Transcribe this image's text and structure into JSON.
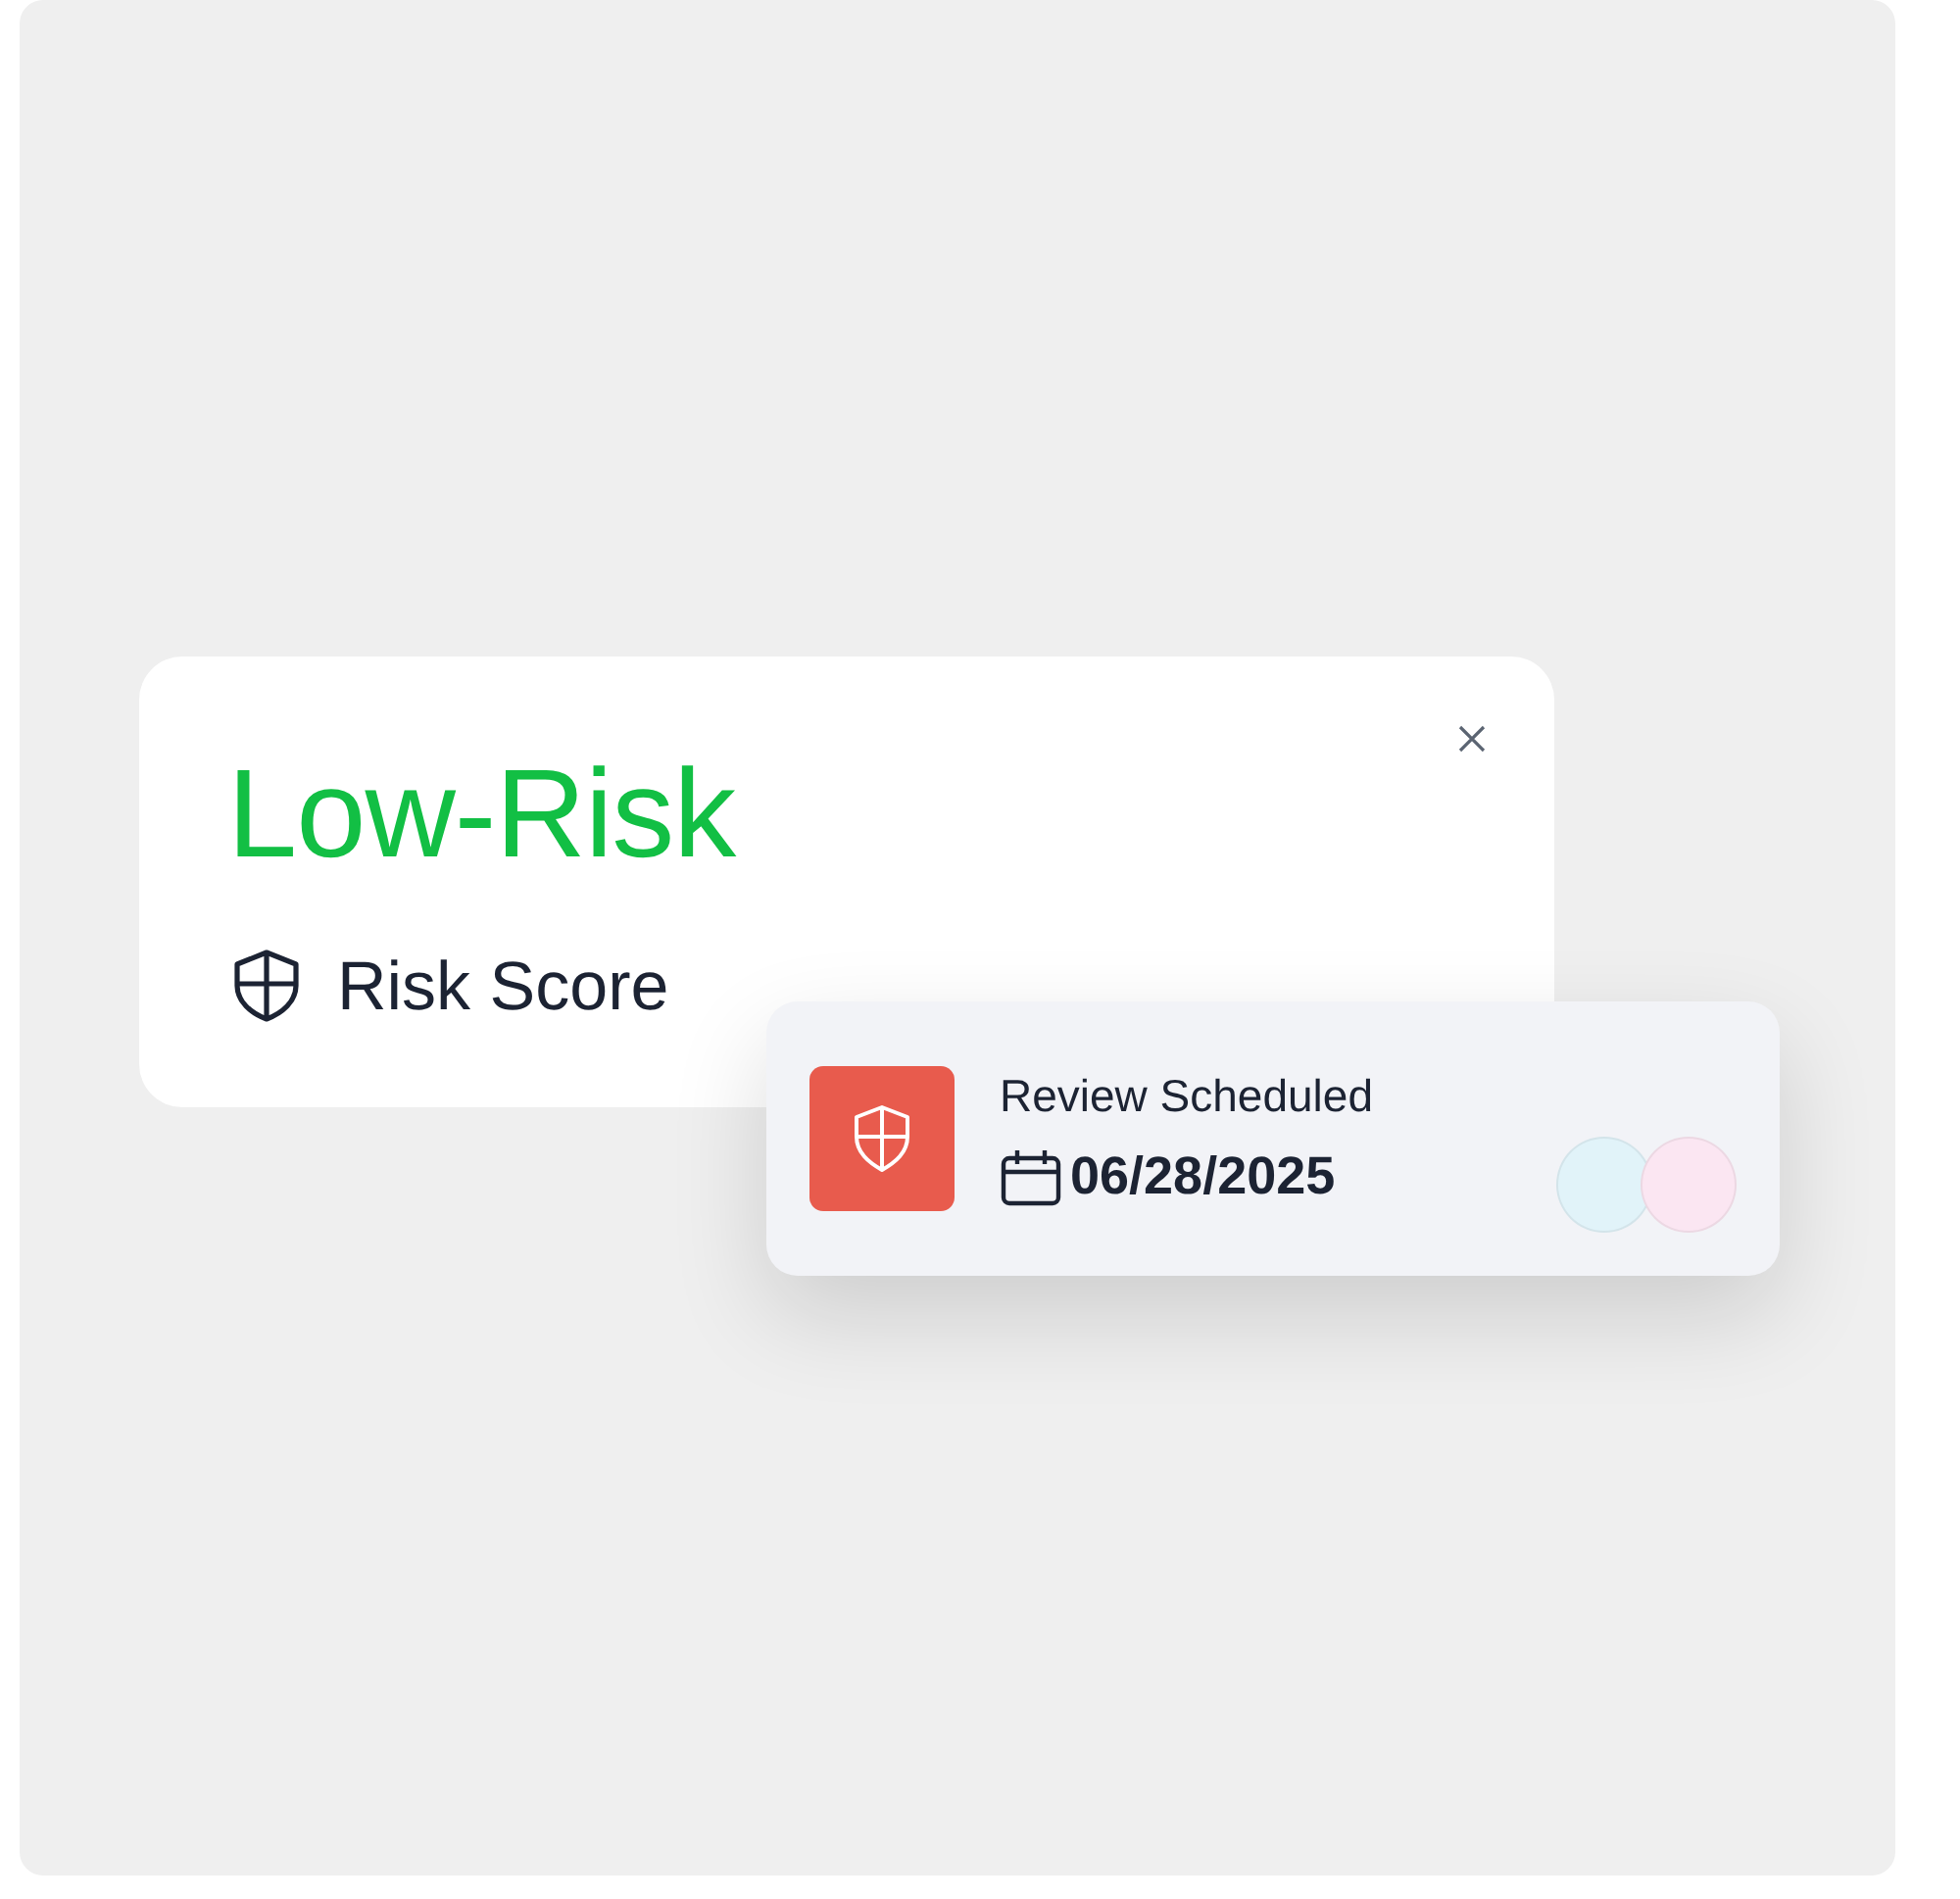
{
  "risk_card": {
    "title": "Low-Risk",
    "label": "Risk Score"
  },
  "review_card": {
    "title": "Review Scheduled",
    "date": "06/28/2025",
    "avatars": [
      {
        "color": "#e1f3f9"
      },
      {
        "color": "#fbe6f2"
      }
    ]
  }
}
